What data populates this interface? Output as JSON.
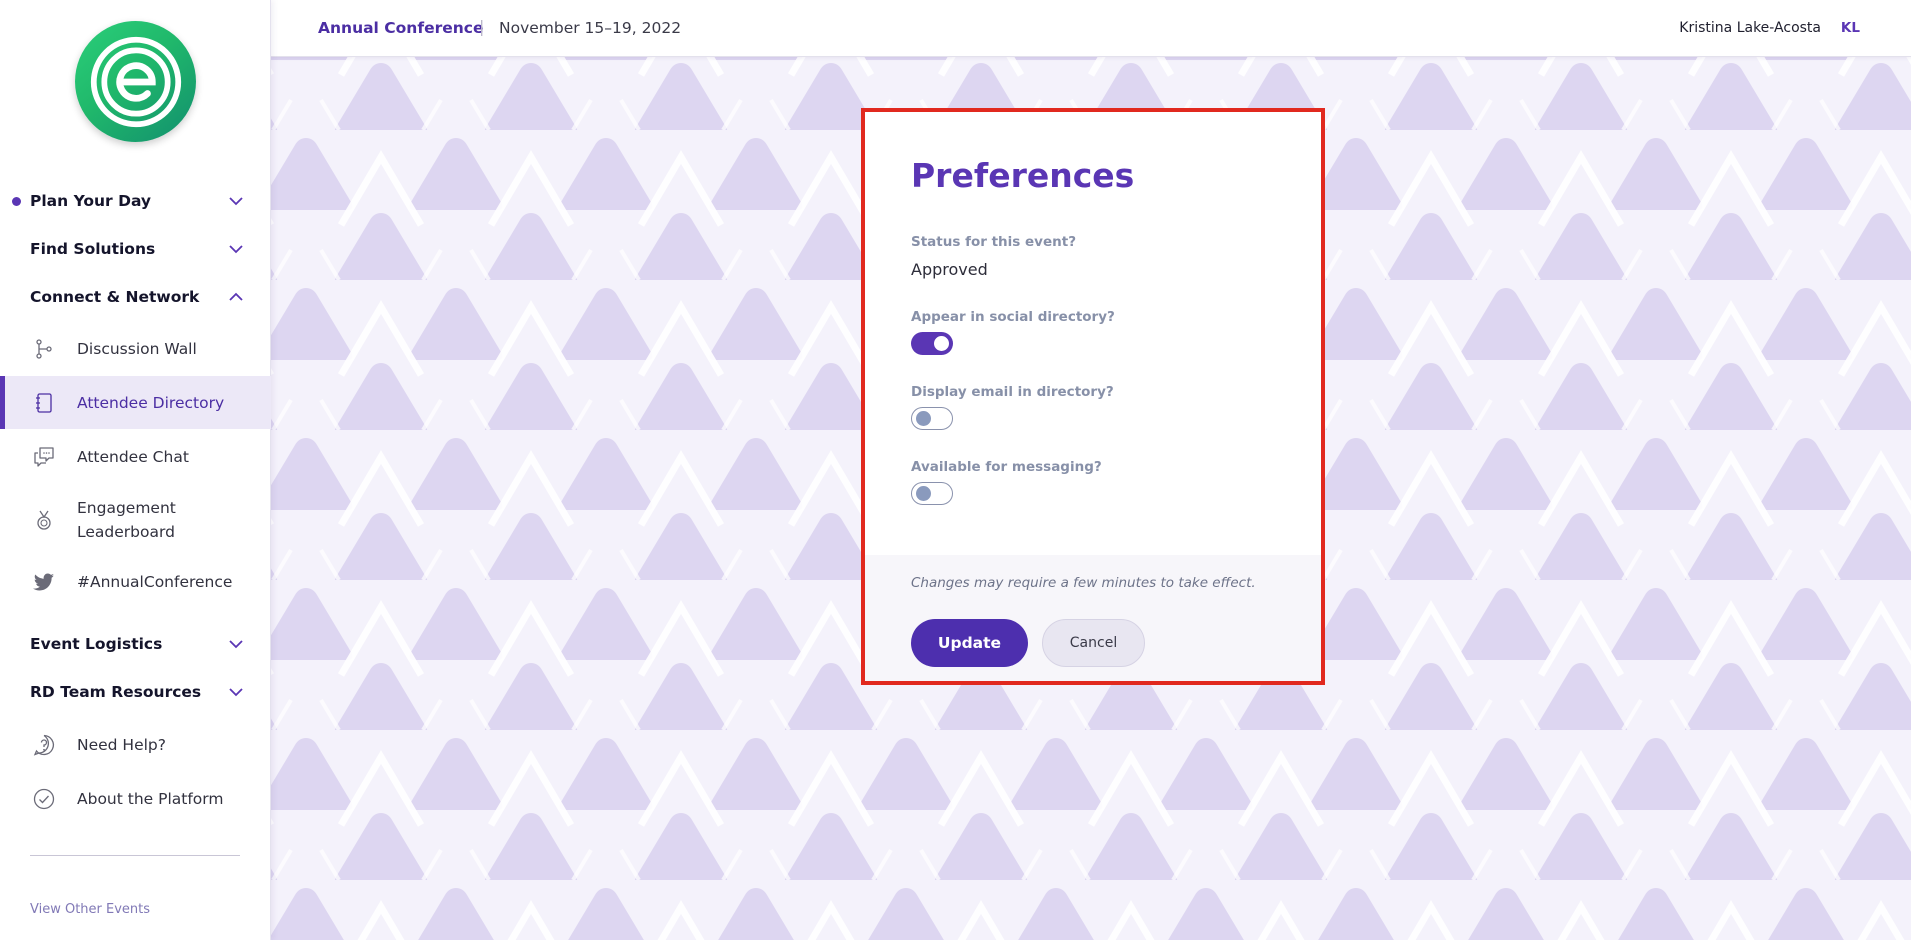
{
  "header": {
    "event_name": "Annual Conference",
    "separator": "|",
    "event_dates": "November 15–19, 2022",
    "user_name": "Kristina Lake-Acosta",
    "user_initials": "KL"
  },
  "sidebar": {
    "logo_icon": "eventcore-logo-icon",
    "sections": [
      {
        "label": "Plan Your Day",
        "expanded": false,
        "current": true
      },
      {
        "label": "Find Solutions",
        "expanded": false
      },
      {
        "label": "Connect & Network",
        "expanded": true
      },
      {
        "label": "Event Logistics",
        "expanded": false
      },
      {
        "label": "RD Team Resources",
        "expanded": false
      }
    ],
    "connect_items": [
      {
        "label": "Discussion Wall",
        "icon": "branch-icon"
      },
      {
        "label": "Attendee Directory",
        "icon": "notebook-icon",
        "active": true
      },
      {
        "label": "Attendee Chat",
        "icon": "chat-icon"
      },
      {
        "label": "Engagement Leaderboard",
        "label_line1": "Engagement",
        "label_line2": "Leaderboard",
        "icon": "medal-icon"
      },
      {
        "label": "#AnnualConference",
        "icon": "twitter-icon"
      }
    ],
    "footer_items": [
      {
        "label": "Need Help?",
        "icon": "help-icon"
      },
      {
        "label": "About the Platform",
        "icon": "check-circle-icon"
      }
    ],
    "view_other_events": "View Other Events"
  },
  "modal": {
    "title": "Preferences",
    "status_label": "Status for this event?",
    "status_value": "Approved",
    "toggles": [
      {
        "label": "Appear in social directory?",
        "on": true
      },
      {
        "label": "Display email in directory?",
        "on": false
      },
      {
        "label": "Available for messaging?",
        "on": false
      }
    ],
    "note": "Changes may require a few minutes to take effect.",
    "update_label": "Update",
    "cancel_label": "Cancel"
  },
  "colors": {
    "accent": "#5a36b4",
    "highlight_border": "#e1291f",
    "background": "#f4f2fb"
  }
}
